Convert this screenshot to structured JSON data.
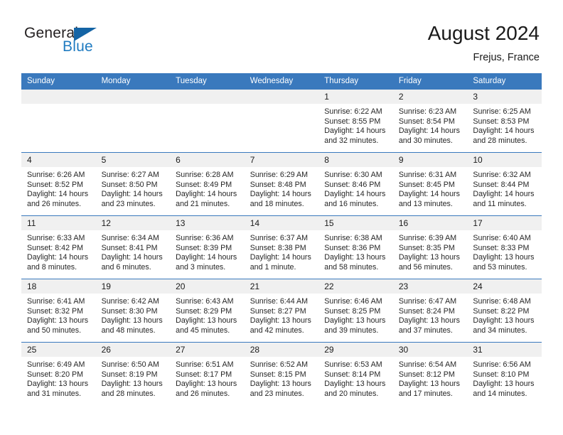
{
  "brand": {
    "name_top": "General",
    "name_bottom": "Blue",
    "accent_color": "#1464a5",
    "text_color": "#231f20"
  },
  "header": {
    "title": "August 2024",
    "location": "Frejus, France",
    "header_bg": "#3a79bd",
    "header_text": "#ffffff"
  },
  "weekday_headers": [
    "Sunday",
    "Monday",
    "Tuesday",
    "Wednesday",
    "Thursday",
    "Friday",
    "Saturday"
  ],
  "weeks": [
    [
      {
        "day": "",
        "empty": true,
        "sunrise": "",
        "sunset": "",
        "daylight_1": "",
        "daylight_2": ""
      },
      {
        "day": "",
        "empty": true,
        "sunrise": "",
        "sunset": "",
        "daylight_1": "",
        "daylight_2": ""
      },
      {
        "day": "",
        "empty": true,
        "sunrise": "",
        "sunset": "",
        "daylight_1": "",
        "daylight_2": ""
      },
      {
        "day": "",
        "empty": true,
        "sunrise": "",
        "sunset": "",
        "daylight_1": "",
        "daylight_2": ""
      },
      {
        "day": "1",
        "sunrise": "Sunrise: 6:22 AM",
        "sunset": "Sunset: 8:55 PM",
        "daylight_1": "Daylight: 14 hours",
        "daylight_2": "and 32 minutes."
      },
      {
        "day": "2",
        "sunrise": "Sunrise: 6:23 AM",
        "sunset": "Sunset: 8:54 PM",
        "daylight_1": "Daylight: 14 hours",
        "daylight_2": "and 30 minutes."
      },
      {
        "day": "3",
        "sunrise": "Sunrise: 6:25 AM",
        "sunset": "Sunset: 8:53 PM",
        "daylight_1": "Daylight: 14 hours",
        "daylight_2": "and 28 minutes."
      }
    ],
    [
      {
        "day": "4",
        "sunrise": "Sunrise: 6:26 AM",
        "sunset": "Sunset: 8:52 PM",
        "daylight_1": "Daylight: 14 hours",
        "daylight_2": "and 26 minutes."
      },
      {
        "day": "5",
        "sunrise": "Sunrise: 6:27 AM",
        "sunset": "Sunset: 8:50 PM",
        "daylight_1": "Daylight: 14 hours",
        "daylight_2": "and 23 minutes."
      },
      {
        "day": "6",
        "sunrise": "Sunrise: 6:28 AM",
        "sunset": "Sunset: 8:49 PM",
        "daylight_1": "Daylight: 14 hours",
        "daylight_2": "and 21 minutes."
      },
      {
        "day": "7",
        "sunrise": "Sunrise: 6:29 AM",
        "sunset": "Sunset: 8:48 PM",
        "daylight_1": "Daylight: 14 hours",
        "daylight_2": "and 18 minutes."
      },
      {
        "day": "8",
        "sunrise": "Sunrise: 6:30 AM",
        "sunset": "Sunset: 8:46 PM",
        "daylight_1": "Daylight: 14 hours",
        "daylight_2": "and 16 minutes."
      },
      {
        "day": "9",
        "sunrise": "Sunrise: 6:31 AM",
        "sunset": "Sunset: 8:45 PM",
        "daylight_1": "Daylight: 14 hours",
        "daylight_2": "and 13 minutes."
      },
      {
        "day": "10",
        "sunrise": "Sunrise: 6:32 AM",
        "sunset": "Sunset: 8:44 PM",
        "daylight_1": "Daylight: 14 hours",
        "daylight_2": "and 11 minutes."
      }
    ],
    [
      {
        "day": "11",
        "sunrise": "Sunrise: 6:33 AM",
        "sunset": "Sunset: 8:42 PM",
        "daylight_1": "Daylight: 14 hours",
        "daylight_2": "and 8 minutes."
      },
      {
        "day": "12",
        "sunrise": "Sunrise: 6:34 AM",
        "sunset": "Sunset: 8:41 PM",
        "daylight_1": "Daylight: 14 hours",
        "daylight_2": "and 6 minutes."
      },
      {
        "day": "13",
        "sunrise": "Sunrise: 6:36 AM",
        "sunset": "Sunset: 8:39 PM",
        "daylight_1": "Daylight: 14 hours",
        "daylight_2": "and 3 minutes."
      },
      {
        "day": "14",
        "sunrise": "Sunrise: 6:37 AM",
        "sunset": "Sunset: 8:38 PM",
        "daylight_1": "Daylight: 14 hours",
        "daylight_2": "and 1 minute."
      },
      {
        "day": "15",
        "sunrise": "Sunrise: 6:38 AM",
        "sunset": "Sunset: 8:36 PM",
        "daylight_1": "Daylight: 13 hours",
        "daylight_2": "and 58 minutes."
      },
      {
        "day": "16",
        "sunrise": "Sunrise: 6:39 AM",
        "sunset": "Sunset: 8:35 PM",
        "daylight_1": "Daylight: 13 hours",
        "daylight_2": "and 56 minutes."
      },
      {
        "day": "17",
        "sunrise": "Sunrise: 6:40 AM",
        "sunset": "Sunset: 8:33 PM",
        "daylight_1": "Daylight: 13 hours",
        "daylight_2": "and 53 minutes."
      }
    ],
    [
      {
        "day": "18",
        "sunrise": "Sunrise: 6:41 AM",
        "sunset": "Sunset: 8:32 PM",
        "daylight_1": "Daylight: 13 hours",
        "daylight_2": "and 50 minutes."
      },
      {
        "day": "19",
        "sunrise": "Sunrise: 6:42 AM",
        "sunset": "Sunset: 8:30 PM",
        "daylight_1": "Daylight: 13 hours",
        "daylight_2": "and 48 minutes."
      },
      {
        "day": "20",
        "sunrise": "Sunrise: 6:43 AM",
        "sunset": "Sunset: 8:29 PM",
        "daylight_1": "Daylight: 13 hours",
        "daylight_2": "and 45 minutes."
      },
      {
        "day": "21",
        "sunrise": "Sunrise: 6:44 AM",
        "sunset": "Sunset: 8:27 PM",
        "daylight_1": "Daylight: 13 hours",
        "daylight_2": "and 42 minutes."
      },
      {
        "day": "22",
        "sunrise": "Sunrise: 6:46 AM",
        "sunset": "Sunset: 8:25 PM",
        "daylight_1": "Daylight: 13 hours",
        "daylight_2": "and 39 minutes."
      },
      {
        "day": "23",
        "sunrise": "Sunrise: 6:47 AM",
        "sunset": "Sunset: 8:24 PM",
        "daylight_1": "Daylight: 13 hours",
        "daylight_2": "and 37 minutes."
      },
      {
        "day": "24",
        "sunrise": "Sunrise: 6:48 AM",
        "sunset": "Sunset: 8:22 PM",
        "daylight_1": "Daylight: 13 hours",
        "daylight_2": "and 34 minutes."
      }
    ],
    [
      {
        "day": "25",
        "sunrise": "Sunrise: 6:49 AM",
        "sunset": "Sunset: 8:20 PM",
        "daylight_1": "Daylight: 13 hours",
        "daylight_2": "and 31 minutes."
      },
      {
        "day": "26",
        "sunrise": "Sunrise: 6:50 AM",
        "sunset": "Sunset: 8:19 PM",
        "daylight_1": "Daylight: 13 hours",
        "daylight_2": "and 28 minutes."
      },
      {
        "day": "27",
        "sunrise": "Sunrise: 6:51 AM",
        "sunset": "Sunset: 8:17 PM",
        "daylight_1": "Daylight: 13 hours",
        "daylight_2": "and 26 minutes."
      },
      {
        "day": "28",
        "sunrise": "Sunrise: 6:52 AM",
        "sunset": "Sunset: 8:15 PM",
        "daylight_1": "Daylight: 13 hours",
        "daylight_2": "and 23 minutes."
      },
      {
        "day": "29",
        "sunrise": "Sunrise: 6:53 AM",
        "sunset": "Sunset: 8:14 PM",
        "daylight_1": "Daylight: 13 hours",
        "daylight_2": "and 20 minutes."
      },
      {
        "day": "30",
        "sunrise": "Sunrise: 6:54 AM",
        "sunset": "Sunset: 8:12 PM",
        "daylight_1": "Daylight: 13 hours",
        "daylight_2": "and 17 minutes."
      },
      {
        "day": "31",
        "sunrise": "Sunrise: 6:56 AM",
        "sunset": "Sunset: 8:10 PM",
        "daylight_1": "Daylight: 13 hours",
        "daylight_2": "and 14 minutes."
      }
    ]
  ]
}
